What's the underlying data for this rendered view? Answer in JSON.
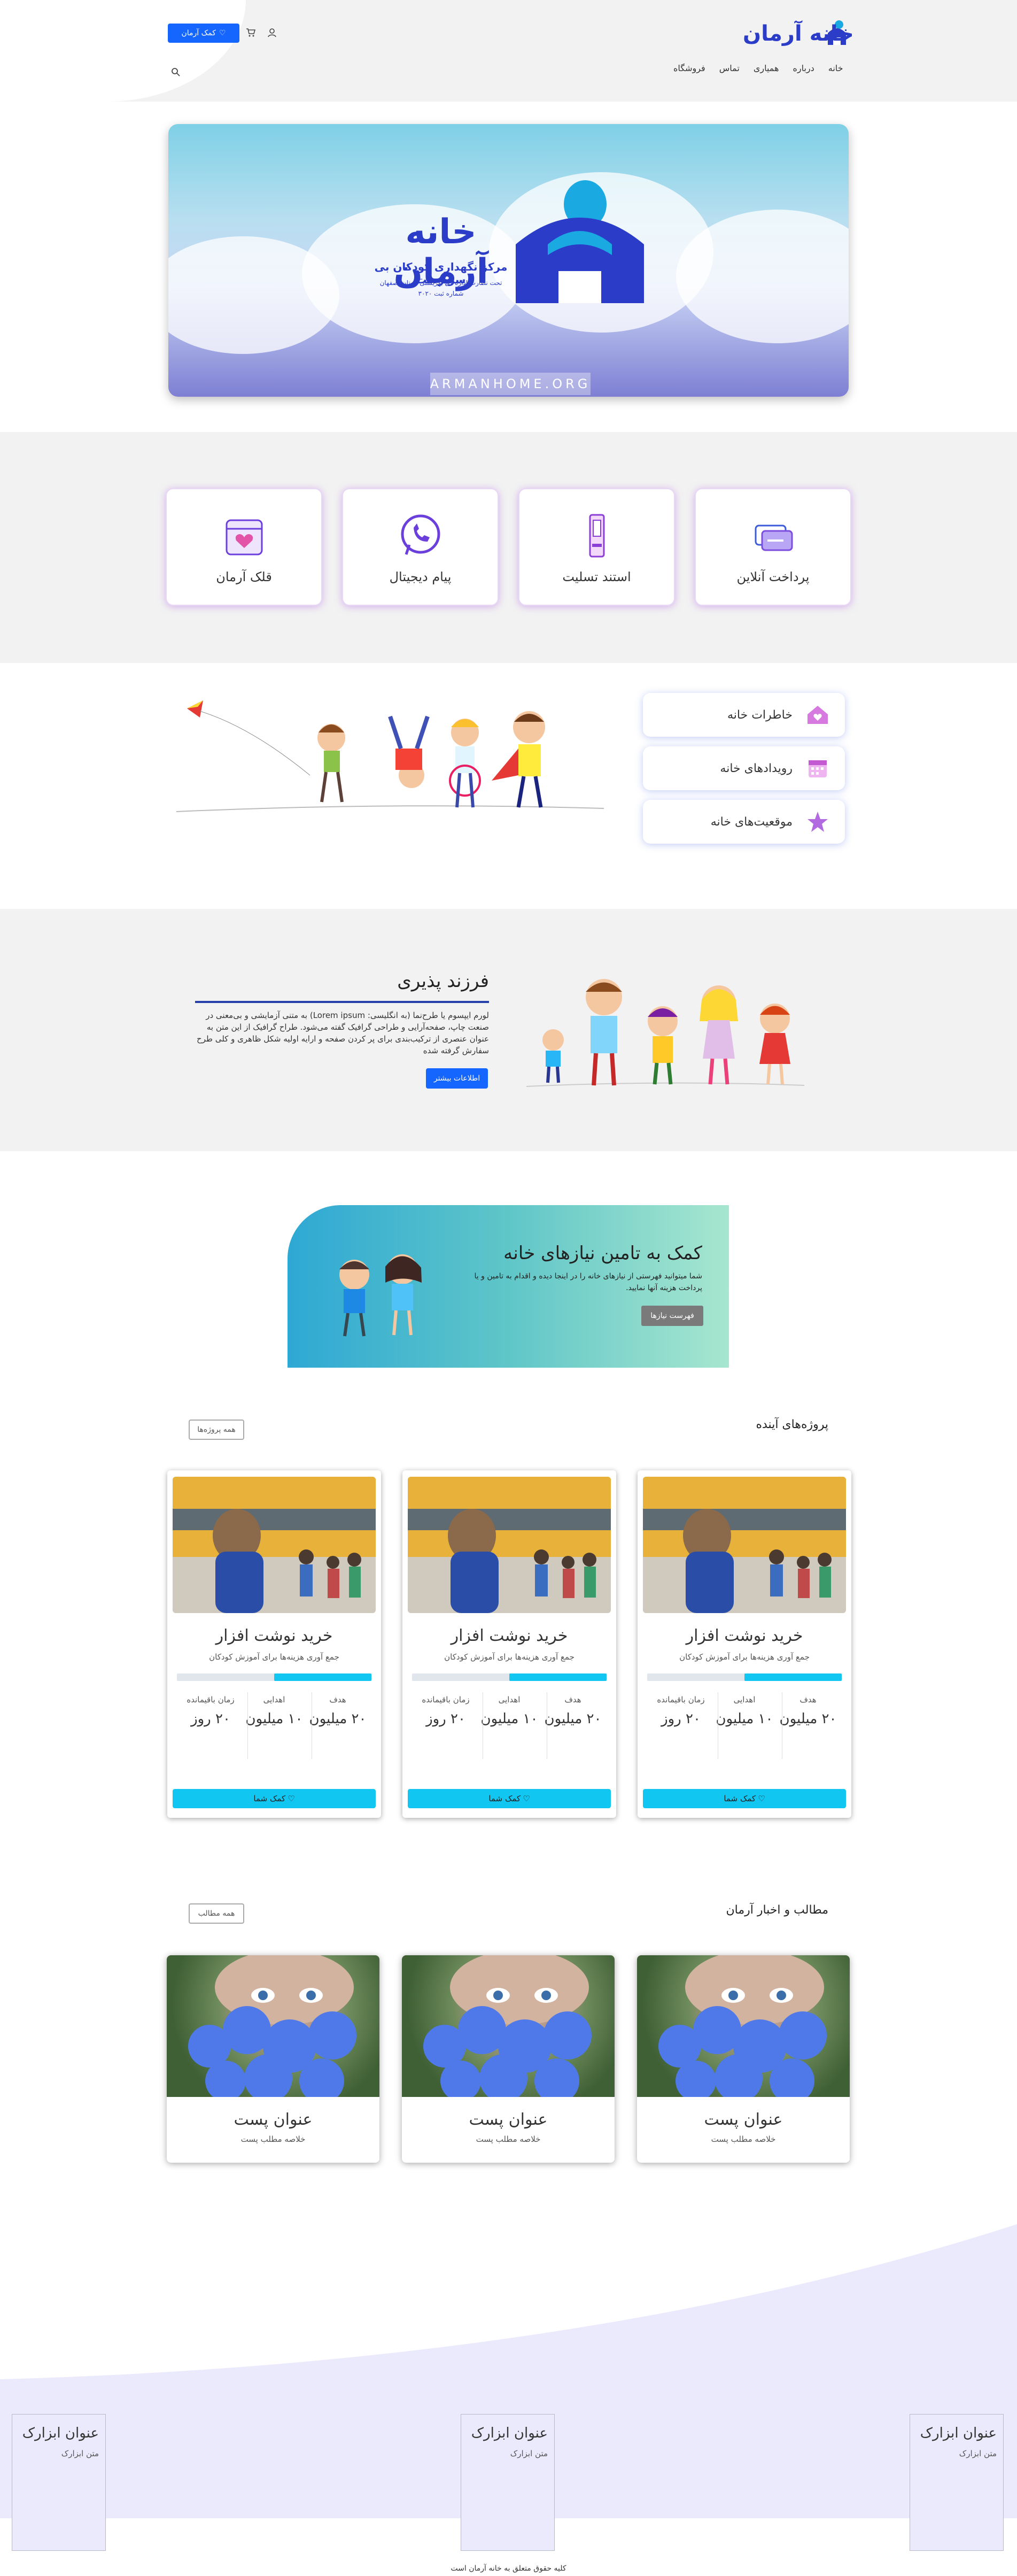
{
  "header": {
    "logo_text": "خانه آرمان",
    "nav": [
      "خانه",
      "درباره",
      "همیاری",
      "تماس",
      "فروشگاه"
    ],
    "donate_label": "کمک آرمان",
    "icons": [
      "user-icon",
      "cart-icon",
      "search-icon",
      "heart-icon"
    ]
  },
  "banner": {
    "title": "خانه آرمان",
    "subtitle": "مرکز نگهداری کودکان بی سرپرست",
    "line2": "تحت نظارت اداره کل بهزیستی استان اصفهان",
    "line3": "شماره ثبت ۳۰۲۰",
    "url": "ARMANHOME.ORG"
  },
  "services": [
    {
      "label": "پرداخت آنلاین",
      "icon": "online-payment-icon"
    },
    {
      "label": "استند تسلیت",
      "icon": "condolence-stand-icon"
    },
    {
      "label": "پیام دیجیتال",
      "icon": "digital-message-icon"
    },
    {
      "label": "قلک آرمان",
      "icon": "piggy-bank-icon"
    }
  ],
  "features": [
    {
      "label": "خاطرات خانه",
      "icon": "house-icon"
    },
    {
      "label": "رویدادهای خانه",
      "icon": "calendar-icon"
    },
    {
      "label": "موقعیت‌های خانه",
      "icon": "star-icon"
    }
  ],
  "adoption": {
    "title": "فرزند پذیری",
    "text": "لورم ایپسوم یا طرح‌نما (به انگلیسی: Lorem ipsum) به متنی آزمایشی و بی‌معنی در صنعت چاپ، صفحه‌آرایی و طراحی گرافیک گفته می‌شود. طراح گرافیک از این متن به عنوان عنصری از ترکیب‌بندی برای پر کردن صفحه و ارایه اولیه شکل ظاهری و کلی طرح سفارش گرفته شده",
    "button": "اطلاعات بیشتر"
  },
  "need": {
    "title": "کمک به تامین نیازهای خانه",
    "text": "شما میتوانید فهرستی از نیازهای خانه را در اینجا دیده و اقدام به تامین و یا پرداخت هزینه آنها نمایید.",
    "button": "فهرست نیازها"
  },
  "projects": {
    "title": "پروژه‌های آینده",
    "all_button": "همه پروژه‌ها",
    "items": [
      {
        "title": "خرید نوشت افزار",
        "subtitle": "جمع آوری هزینه‌ها برای آموزش کودکان",
        "progress": 0.5,
        "stats": [
          {
            "label": "هدف",
            "value": "۲۰ میلیون"
          },
          {
            "label": "اهدایی",
            "value": "۱۰ میلیون"
          },
          {
            "label": "زمان باقیمانده",
            "value": "۲۰ روز"
          }
        ],
        "button": "کمک شما"
      },
      {
        "title": "خرید نوشت افزار",
        "subtitle": "جمع آوری هزینه‌ها برای آموزش کودکان",
        "progress": 0.5,
        "stats": [
          {
            "label": "هدف",
            "value": "۲۰ میلیون"
          },
          {
            "label": "اهدایی",
            "value": "۱۰ میلیون"
          },
          {
            "label": "زمان باقیمانده",
            "value": "۲۰ روز"
          }
        ],
        "button": "کمک شما"
      },
      {
        "title": "خرید نوشت افزار",
        "subtitle": "جمع آوری هزینه‌ها برای آموزش کودکان",
        "progress": 0.5,
        "stats": [
          {
            "label": "هدف",
            "value": "۲۰ میلیون"
          },
          {
            "label": "اهدایی",
            "value": "۱۰ میلیون"
          },
          {
            "label": "زمان باقیمانده",
            "value": "۲۰ روز"
          }
        ],
        "button": "کمک شما"
      }
    ]
  },
  "posts": {
    "title": "مطالب و اخبار آرمان",
    "all_button": "همه مطالب",
    "items": [
      {
        "title": "عنوان پست",
        "excerpt": "خلاصه مطلب پست"
      },
      {
        "title": "عنوان پست",
        "excerpt": "خلاصه مطلب پست"
      },
      {
        "title": "عنوان پست",
        "excerpt": "خلاصه مطلب پست"
      }
    ]
  },
  "footer": {
    "widgets": [
      {
        "title": "عنوان ابزارک",
        "text": "متن ابزارک"
      },
      {
        "title": "عنوان ابزارک",
        "text": "متن ابزارک"
      },
      {
        "title": "عنوان ابزارک",
        "text": "متن ابزارک"
      }
    ],
    "copyright": "کلیه حقوق متعلق به خانه آرمان است"
  },
  "colors": {
    "primary": "#1565ff",
    "brand": "#2b3cc8",
    "accent": "#12c6f2",
    "bg": "#f2f2f2"
  }
}
